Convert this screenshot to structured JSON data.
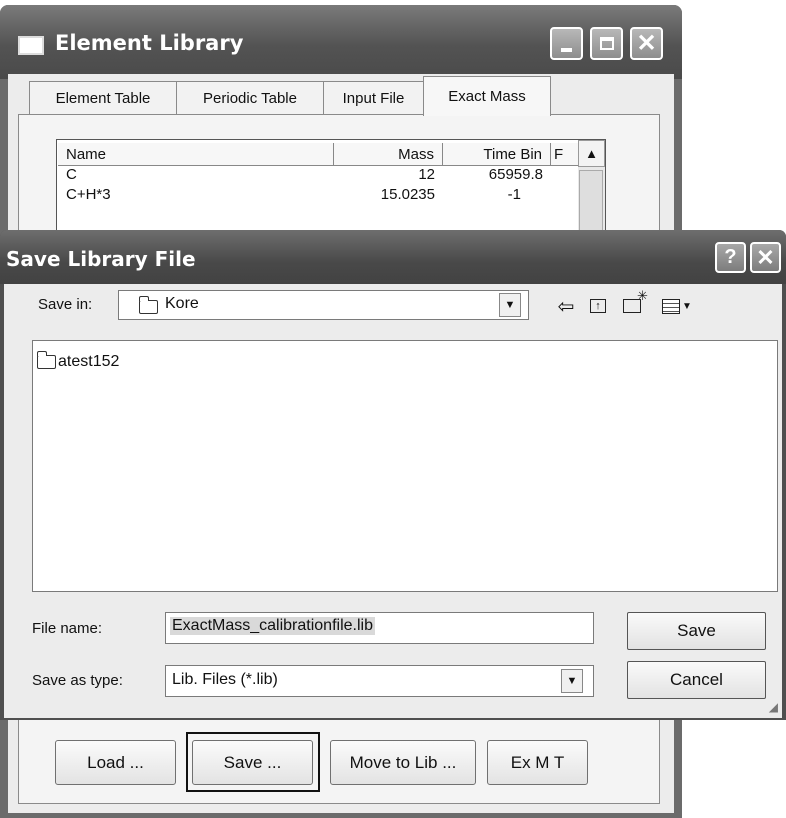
{
  "element_library": {
    "title": "Element Library",
    "tabs": [
      "Element Table",
      "Periodic Table",
      "Input File",
      "Exact Mass"
    ],
    "active_tab": "Exact Mass",
    "columns": [
      "Name",
      "Mass",
      "Time Bin",
      "F"
    ],
    "rows": [
      {
        "name": "C",
        "mass": "12",
        "time_bin": "65959.8"
      },
      {
        "name": "C+H*3",
        "mass": "15.0235",
        "time_bin": "-1"
      }
    ],
    "buttons": {
      "load": "Load ...",
      "save": "Save ...",
      "move_to_lib": "Move to Lib ...",
      "ex_m_t": "Ex M T"
    }
  },
  "save_dialog": {
    "title": "Save Library File",
    "help": "?",
    "save_in_label": "Save in:",
    "save_in_value": "Kore",
    "files": [
      "atest152"
    ],
    "file_name_label": "File name:",
    "file_name_value": "ExactMass_calibrationfile.lib",
    "save_as_type_label": "Save as type:",
    "save_as_type_value": "Lib. Files (*.lib)",
    "save_button": "Save",
    "cancel_button": "Cancel"
  }
}
